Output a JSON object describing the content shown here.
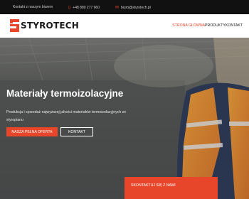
{
  "topbar": {
    "office_label": "Kontakt z naszym biurem",
    "phone": "+48 880 277 960",
    "email": "biuro@styrotech.pl",
    "phone_icon": "phone-icon",
    "email_icon": "envelope-icon"
  },
  "brand": {
    "name": "STYROTECH",
    "logo_icon": "styrotech-logo-icon",
    "accent_color": "#e8462a"
  },
  "nav": {
    "items": [
      {
        "label": "Strona główna",
        "active": true
      },
      {
        "label": "Produkty",
        "active": false
      },
      {
        "label": "Kontakt",
        "active": false
      }
    ]
  },
  "hero": {
    "title": "Materiały termoizolacyjne",
    "description": "Produkcja i sprzedaż najwyższej jakości materiałów termoizolacyjnych ze styropianu",
    "primary_button": "Nasza pełna oferta",
    "secondary_button": "Kontakt",
    "contact_tab": "Skontaktuj się z nami"
  }
}
